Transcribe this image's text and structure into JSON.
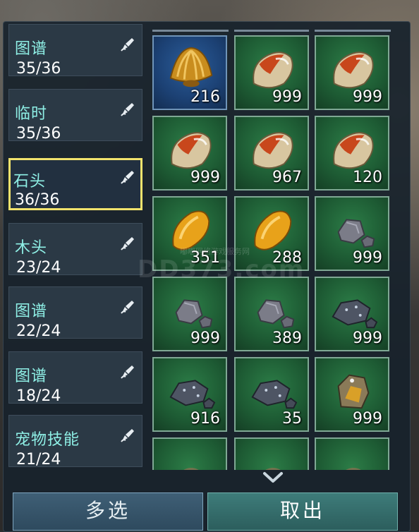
{
  "categories": [
    {
      "name": "图谱",
      "count": "35/36",
      "selected": false
    },
    {
      "name": "临时",
      "count": "35/36",
      "selected": false
    },
    {
      "name": "石头",
      "count": "36/36",
      "selected": true
    },
    {
      "name": "木头",
      "count": "23/24",
      "selected": false
    },
    {
      "name": "图谱",
      "count": "22/24",
      "selected": false
    },
    {
      "name": "图谱",
      "count": "18/24",
      "selected": false
    },
    {
      "name": "宠物技能",
      "count": "21/24",
      "selected": false
    }
  ],
  "category_icon": "edit-brush-icon",
  "items": [
    {
      "icon": "golden-shell-icon",
      "qty": "216",
      "bg": "blue"
    },
    {
      "icon": "orange-stone-icon",
      "qty": "999",
      "bg": "green"
    },
    {
      "icon": "orange-stone-icon",
      "qty": "999",
      "bg": "green"
    },
    {
      "icon": "orange-stone-icon",
      "qty": "999",
      "bg": "green"
    },
    {
      "icon": "orange-stone-icon",
      "qty": "967",
      "bg": "green"
    },
    {
      "icon": "orange-stone-icon",
      "qty": "120",
      "bg": "green"
    },
    {
      "icon": "amber-stone-icon",
      "qty": "351",
      "bg": "green"
    },
    {
      "icon": "amber-stone-icon",
      "qty": "288",
      "bg": "green"
    },
    {
      "icon": "gray-rock-icon",
      "qty": "999",
      "bg": "green"
    },
    {
      "icon": "gray-rock-icon",
      "qty": "999",
      "bg": "green"
    },
    {
      "icon": "gray-rock-icon",
      "qty": "389",
      "bg": "green"
    },
    {
      "icon": "dark-ore-icon",
      "qty": "999",
      "bg": "green"
    },
    {
      "icon": "dark-ore-icon",
      "qty": "916",
      "bg": "green"
    },
    {
      "icon": "dark-ore-icon",
      "qty": "35",
      "bg": "green"
    },
    {
      "icon": "gold-ore-icon",
      "qty": "999",
      "bg": "green"
    },
    {
      "icon": "partial-item-icon",
      "qty": "",
      "bg": "green"
    },
    {
      "icon": "partial-item-icon",
      "qty": "",
      "bg": "green"
    },
    {
      "icon": "partial-item-icon",
      "qty": "",
      "bg": "green"
    }
  ],
  "watermark": "DD373.com",
  "watermark_small": "嘟嘟网络游戏服务网",
  "buttons": {
    "multi_select": "多选",
    "take_out": "取出"
  },
  "colors": {
    "selected_border": "#f2e36c",
    "category_name": "#8ff0e6"
  }
}
